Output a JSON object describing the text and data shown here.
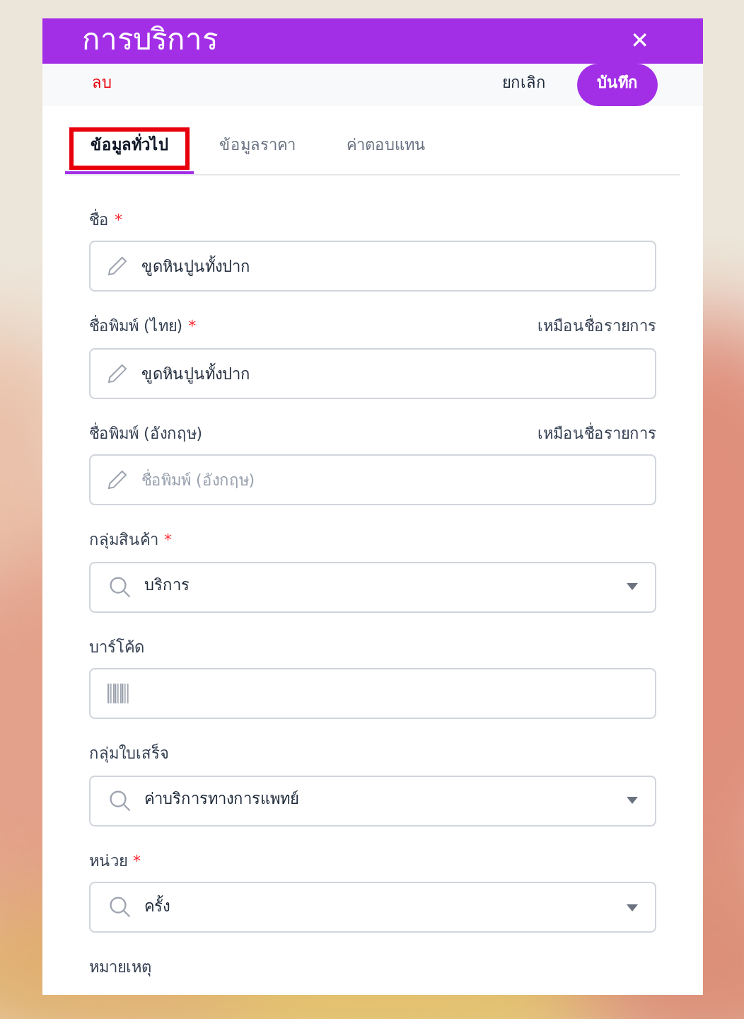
{
  "dialog": {
    "title": "การบริการ",
    "close": "✕"
  },
  "actions": {
    "delete": "ลบ",
    "cancel": "ยกเลิก",
    "save": "บันทึก"
  },
  "tabs": [
    {
      "label": "ข้อมูลทั่วไป",
      "selected": true,
      "highlighted": true
    },
    {
      "label": "ข้อมูลราคา",
      "selected": false,
      "highlighted": false
    },
    {
      "label": "ค่าตอบแทน",
      "selected": false,
      "highlighted": false
    }
  ],
  "fields": [
    {
      "kind": "text",
      "label": "ชื่อ",
      "required_mark": "*",
      "value": "ขูดหินปูนทั้งปาก"
    },
    {
      "kind": "text",
      "label": "ชื่อพิมพ์ (ไทย)",
      "required_mark": "*",
      "hint": "เหมือนชื่อรายการ",
      "value": "ขูดหินปูนทั้งปาก"
    },
    {
      "kind": "text",
      "label": "ชื่อพิมพ์ (อังกฤษ)",
      "hint": "เหมือนชื่อรายการ",
      "placeholder": "ชื่อพิมพ์ (อังกฤษ)"
    },
    {
      "kind": "select",
      "label": "กลุ่มสินค้า",
      "required_mark": "*",
      "value": "บริการ"
    },
    {
      "kind": "barcode",
      "label": "บาร์โค้ด"
    },
    {
      "kind": "select",
      "label": "กลุ่มใบเสร็จ",
      "value": "ค่าบริการทางการแพทย์"
    },
    {
      "kind": "select",
      "label": "หน่วย",
      "required_mark": "*",
      "value": "ครั้ง"
    },
    {
      "kind": "label",
      "label": "หมายเหตุ"
    }
  ]
}
